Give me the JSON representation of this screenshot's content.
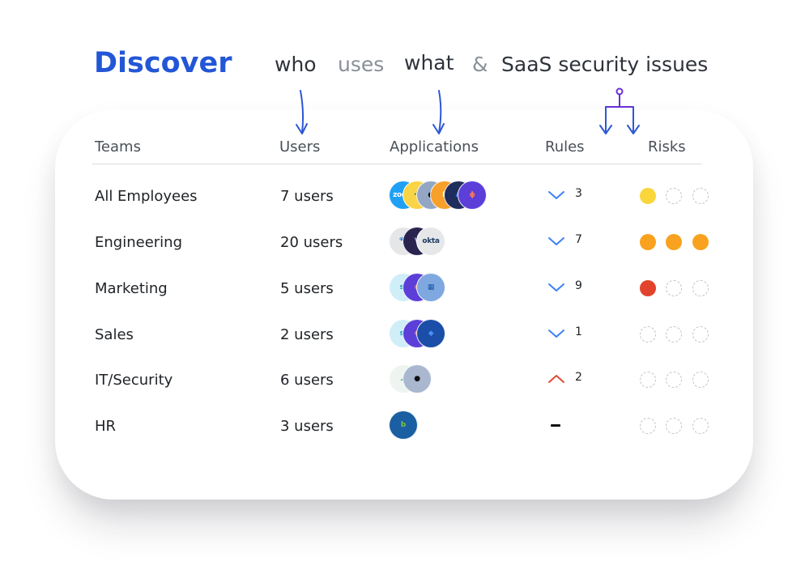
{
  "headline": {
    "discover": "Discover",
    "who": "who",
    "uses": "uses",
    "what": "what",
    "amp": "&",
    "saas": "SaaS security issues"
  },
  "columns": {
    "teams": "Teams",
    "users": "Users",
    "applications": "Applications",
    "rules": "Rules",
    "risks": "Risks"
  },
  "colors": {
    "accent": "#2356d6",
    "arrow_blue": "#2d57d4",
    "arrow_purple": "#6b2fd6",
    "rule_down": "#3b82f6",
    "rule_up": "#e04a32",
    "risk_yellow": "#fbd63b",
    "risk_orange": "#f8a21f",
    "risk_red": "#e1432c"
  },
  "rows": [
    {
      "team": "All Employees",
      "users": "7 users",
      "apps": [
        {
          "icon": "zoom-icon",
          "bg": "#1fa0f4",
          "fg": "#ffffff",
          "label": "zoom"
        },
        {
          "icon": "slack-icon",
          "bg": "#fad447",
          "fg": "#2b7a5b",
          "label": "✣"
        },
        {
          "icon": "github-icon",
          "bg": "#93a7c4",
          "fg": "#111111",
          "label": "●"
        },
        {
          "icon": "figma-icon",
          "bg": "#f7a02a",
          "fg": "#ffffff",
          "label": "F"
        },
        {
          "icon": "azure-icon",
          "bg": "#1f2d5c",
          "fg": "#3b8ff0",
          "label": "A"
        },
        {
          "icon": "hubspot-icon",
          "bg": "#5b3fd8",
          "fg": "#ff7a59",
          "label": "ɸ"
        }
      ],
      "rules": {
        "direction": "down",
        "count": "3"
      },
      "risks": [
        "#fbd63b",
        "empty",
        "empty"
      ]
    },
    {
      "team": "Engineering",
      "users": "20 users",
      "apps": [
        {
          "icon": "datadog-icon",
          "bg": "#e5e6e8",
          "fg": "#632ca6",
          "label": "🐾"
        },
        {
          "icon": "vercel-icon",
          "bg": "#2a2350",
          "fg": "#b39ddb",
          "label": "V"
        },
        {
          "icon": "okta-icon",
          "bg": "#e6e7e9",
          "fg": "#1f3e63",
          "label": "okta"
        }
      ],
      "rules": {
        "direction": "down",
        "count": "7"
      },
      "risks": [
        "#f8a21f",
        "#f8a21f",
        "#f8a21f"
      ]
    },
    {
      "team": "Marketing",
      "users": "5 users",
      "apps": [
        {
          "icon": "salesforce-icon",
          "bg": "#cfeef8",
          "fg": "#1798c1",
          "label": "sf"
        },
        {
          "icon": "hubspot-icon",
          "bg": "#5b3fd8",
          "fg": "#ff7a59",
          "label": "ɸ"
        },
        {
          "icon": "trello-icon",
          "bg": "#7ea8df",
          "fg": "#1a5aa8",
          "label": "▦"
        }
      ],
      "rules": {
        "direction": "down",
        "count": "9"
      },
      "risks": [
        "#e1432c",
        "empty",
        "empty"
      ]
    },
    {
      "team": "Sales",
      "users": "2 users",
      "apps": [
        {
          "icon": "salesforce-icon",
          "bg": "#cfeef8",
          "fg": "#1798c1",
          "label": "sf"
        },
        {
          "icon": "hubspot-icon",
          "bg": "#5b3fd8",
          "fg": "#ff7a59",
          "label": "ɸ"
        },
        {
          "icon": "jira-icon",
          "bg": "#1a4ea8",
          "fg": "#4a8ff5",
          "label": "◆"
        }
      ],
      "rules": {
        "direction": "down",
        "count": "1"
      },
      "risks": [
        "empty",
        "empty",
        "empty"
      ]
    },
    {
      "team": "IT/Security",
      "users": "6 users",
      "apps": [
        {
          "icon": "team-cloud-icon",
          "bg": "#eef5f1",
          "fg": "#5aaf95",
          "label": "☁"
        },
        {
          "icon": "github-icon",
          "bg": "#a9b8cf",
          "fg": "#111111",
          "label": "●"
        }
      ],
      "rules": {
        "direction": "up",
        "count": "2"
      },
      "risks": [
        "empty",
        "empty",
        "empty"
      ]
    },
    {
      "team": "HR",
      "users": "3 users",
      "apps": [
        {
          "icon": "bamboohr-icon",
          "bg": "#1b5fa3",
          "fg": "#7cc242",
          "label": "b"
        }
      ],
      "rules": {
        "direction": "none",
        "count": ""
      },
      "risks": [
        "empty",
        "empty",
        "empty"
      ]
    }
  ]
}
